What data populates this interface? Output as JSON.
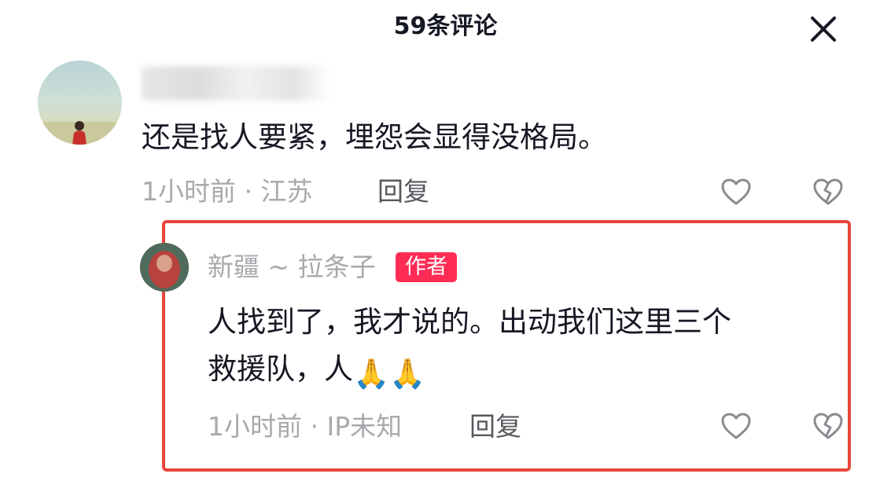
{
  "header": {
    "title": "59条评论",
    "close_icon": "close-icon"
  },
  "comments": [
    {
      "avatar_icon": "avatar",
      "text": "还是找人要紧，埋怨会显得没格局。",
      "time_location": "1小时前 · 江苏",
      "reply_label": "回复",
      "like_icon": "heart-outline-icon",
      "dislike_icon": "broken-heart-icon"
    }
  ],
  "reply": {
    "username": "新疆 ~ 拉条子",
    "badge": "作者",
    "text_line1": "人找到了，我才说的。出动我们这里三个",
    "text_line2": "救援队，人",
    "emoji": "🙏🙏",
    "time_location": "1小时前 · IP未知",
    "reply_label": "回复",
    "like_icon": "heart-outline-icon",
    "dislike_icon": "broken-heart-icon"
  },
  "colors": {
    "highlight_border": "#e8453c",
    "badge_bg": "#fe2c55",
    "meta_text": "#a8a9ad",
    "main_text": "#161823"
  }
}
